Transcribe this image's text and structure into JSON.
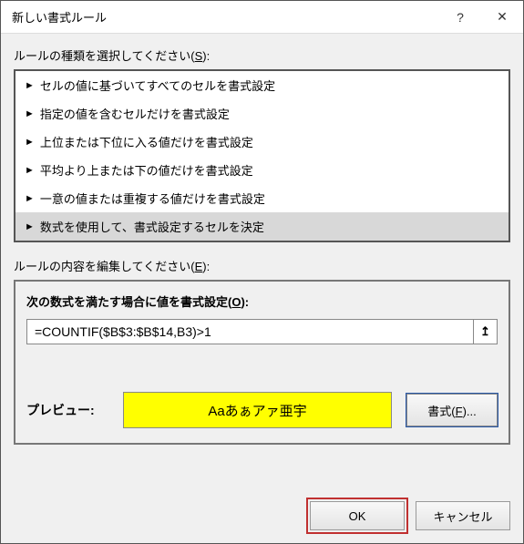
{
  "title": "新しい書式ルール",
  "section_select_label": "ルールの種類を選択してください(",
  "section_select_mn": "S",
  "section_select_after": "):",
  "rule_types": [
    "セルの値に基づいてすべてのセルを書式設定",
    "指定の値を含むセルだけを書式設定",
    "上位または下位に入る値だけを書式設定",
    "平均より上または下の値だけを書式設定",
    "一意の値または重複する値だけを書式設定",
    "数式を使用して、書式設定するセルを決定"
  ],
  "section_edit_label": "ルールの内容を編集してください(",
  "section_edit_mn": "E",
  "section_edit_after": "):",
  "formula_header": "次の数式を満たす場合に値を書式設定(",
  "formula_header_mn": "O",
  "formula_header_after": "):",
  "formula_value": "=COUNTIF($B$3:$B$14,B3)>1",
  "preview_label": "プレビュー:",
  "preview_sample": "Aaあぁアァ亜宇",
  "format_btn_before": "書式(",
  "format_btn_mn": "F",
  "format_btn_after": ")...",
  "ok_label": "OK",
  "cancel_label": "キャンセル"
}
